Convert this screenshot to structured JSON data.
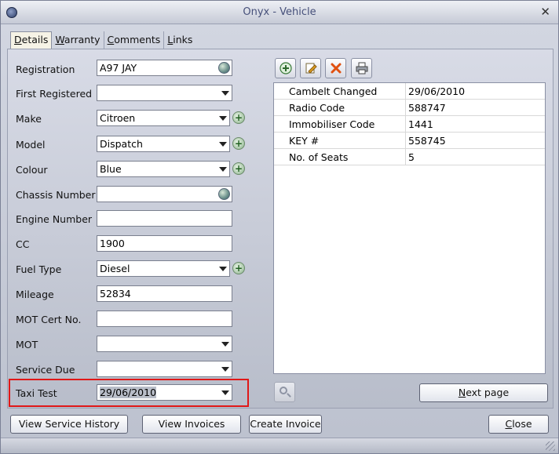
{
  "window": {
    "title": "Onyx - Vehicle",
    "close_glyph": "✕"
  },
  "tabs": [
    {
      "label": "Details",
      "accel": "D",
      "rest": "etails",
      "active": true
    },
    {
      "label": "Warranty",
      "accel": "W",
      "rest": "arranty",
      "active": false
    },
    {
      "label": "Comments",
      "accel": "C",
      "rest": "omments",
      "active": false
    },
    {
      "label": "Links",
      "accel": "L",
      "rest": "inks",
      "active": false
    }
  ],
  "fields": {
    "registration": {
      "label": "Registration",
      "value": "A97 JAY"
    },
    "first_registered": {
      "label": "First Registered",
      "value": ""
    },
    "make": {
      "label": "Make",
      "value": "Citroen"
    },
    "model": {
      "label": "Model",
      "value": "Dispatch"
    },
    "colour": {
      "label": "Colour",
      "value": "Blue"
    },
    "chassis_number": {
      "label": "Chassis Number",
      "value": ""
    },
    "engine_number": {
      "label": "Engine Number",
      "value": ""
    },
    "cc": {
      "label": "CC",
      "value": "1900"
    },
    "fuel_type": {
      "label": "Fuel Type",
      "value": "Diesel"
    },
    "mileage": {
      "label": "Mileage",
      "value": "52834"
    },
    "mot_cert_no": {
      "label": "MOT Cert No.",
      "value": ""
    },
    "mot": {
      "label": "MOT",
      "value": ""
    },
    "service_due": {
      "label": "Service Due",
      "value": ""
    },
    "taxi_test": {
      "label": "Taxi Test",
      "value": "29/06/2010"
    }
  },
  "grid": {
    "rows": [
      {
        "key": "Cambelt Changed",
        "value": "29/06/2010"
      },
      {
        "key": "Radio Code",
        "value": "588747"
      },
      {
        "key": "Immobiliser Code",
        "value": "1441"
      },
      {
        "key": "KEY #",
        "value": "558745"
      },
      {
        "key": "No. of Seats",
        "value": "5"
      }
    ]
  },
  "buttons": {
    "next_page": {
      "accel": "N",
      "rest": "ext page"
    },
    "view_service_history": "View Service History",
    "view_invoices": "View Invoices",
    "create_invoice": "Create Invoice",
    "close": {
      "accel": "C",
      "rest": "lose"
    }
  },
  "icons": {
    "add": "add-icon",
    "edit": "edit-icon",
    "delete": "delete-icon",
    "print": "printer-icon",
    "globe": "globe-icon",
    "magnifier": "magnifier-icon"
  },
  "colors": {
    "highlight": "#e01818",
    "delete": "#e05010",
    "add": "#3a7a3a"
  }
}
